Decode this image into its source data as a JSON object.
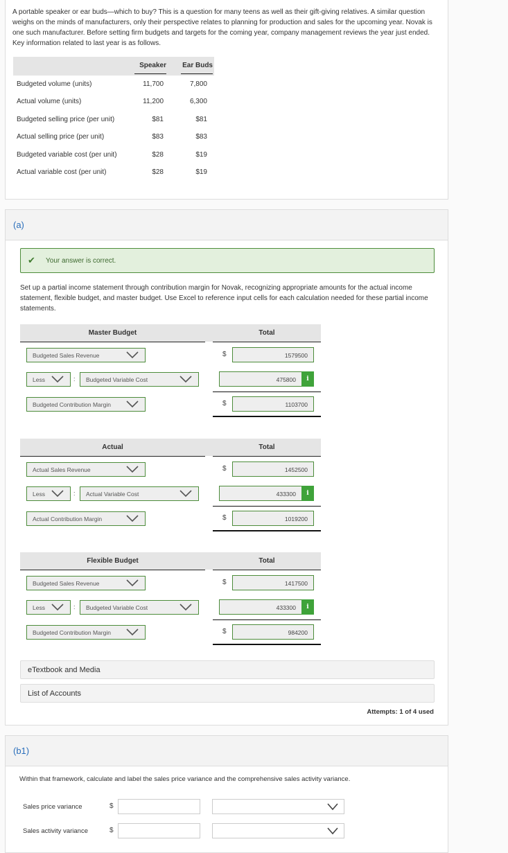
{
  "intro": {
    "text": "A portable speaker or ear buds—which to buy? This is a question for many teens as well as their gift-giving relatives. A similar question weighs on the minds of manufacturers, only their perspective relates to planning for production and sales for the upcoming year. Novak is one such manufacturer. Before setting firm budgets and targets for the coming year, company management reviews the year just ended. Key information related to last year is as follows.",
    "table": {
      "columns": [
        "Speaker",
        "Ear Buds"
      ],
      "rows": [
        {
          "label": "Budgeted volume (units)",
          "speaker": "11,700",
          "ear_buds": "7,800"
        },
        {
          "label": "Actual volume (units)",
          "speaker": "11,200",
          "ear_buds": "6,300"
        },
        {
          "label": "Budgeted selling price (per unit)",
          "speaker": "$81",
          "ear_buds": "$81"
        },
        {
          "label": "Actual selling price (per unit)",
          "speaker": "$83",
          "ear_buds": "$83"
        },
        {
          "label": "Budgeted variable cost (per unit)",
          "speaker": "$28",
          "ear_buds": "$19"
        },
        {
          "label": "Actual variable cost (per unit)",
          "speaker": "$28",
          "ear_buds": "$19"
        }
      ]
    }
  },
  "part_a": {
    "label": "(a)",
    "feedback": "Your answer is correct.",
    "instructions": "Set up a partial income statement through contribution margin for Novak, recognizing appropriate amounts for the actual income statement, flexible budget, and master budget. Use Excel to reference input cells for each calculation needed for these partial income statements.",
    "currency": "$",
    "info_glyph": "i",
    "statements": [
      {
        "title": "Master Budget",
        "total_label": "Total",
        "revenue_select": "Budgeted Sales Revenue",
        "revenue_value": "1579500",
        "operator_select": "Less",
        "separator": ":",
        "cost_select": "Budgeted Variable Cost",
        "cost_value": "475800",
        "margin_select": "Budgeted Contribution Margin",
        "margin_value": "1103700"
      },
      {
        "title": "Actual",
        "total_label": "Total",
        "revenue_select": "Actual Sales Revenue",
        "revenue_value": "1452500",
        "operator_select": "Less",
        "separator": ":",
        "cost_select": "Actual Variable Cost",
        "cost_value": "433300",
        "margin_select": "Actual Contribution Margin",
        "margin_value": "1019200"
      },
      {
        "title": "Flexible Budget",
        "total_label": "Total",
        "revenue_select": "Budgeted Sales Revenue",
        "revenue_value": "1417500",
        "operator_select": "Less",
        "separator": ":",
        "cost_select": "Budgeted Variable Cost",
        "cost_value": "433300",
        "margin_select": "Budgeted Contribution Margin",
        "margin_value": "984200"
      }
    ],
    "etextbook_label": "eTextbook and Media",
    "list_of_accounts_label": "List of Accounts",
    "attempts": "Attempts: 1 of 4 used"
  },
  "part_b1": {
    "label": "(b1)",
    "instructions": "Within that framework, calculate and label the sales price variance and the comprehensive sales activity variance.",
    "currency": "$",
    "rows": [
      {
        "label": "Sales price variance",
        "value": "",
        "selection": ""
      },
      {
        "label": "Sales activity variance",
        "value": "",
        "selection": ""
      }
    ]
  },
  "colors": {
    "link_blue": "#2a6ebb",
    "correct_green": "#4c8c3a",
    "info_green": "#3fa33a"
  }
}
